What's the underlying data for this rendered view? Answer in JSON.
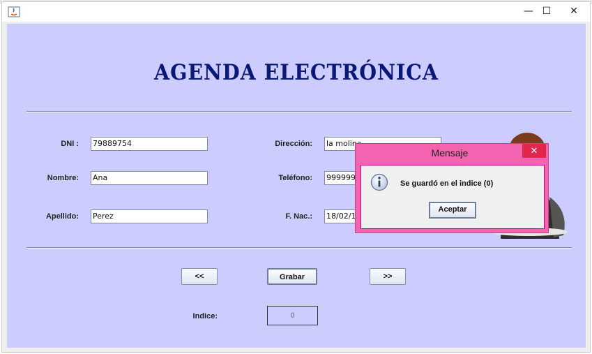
{
  "window": {
    "minimize": "—",
    "maximize": "☐",
    "close": "✕"
  },
  "form": {
    "title": "AGENDA ELECTRÓNICA",
    "dni_label": "DNI :",
    "dni_value": "79889754",
    "nombre_label": "Nombre:",
    "nombre_value": "Ana",
    "apellido_label": "Apellido:",
    "apellido_value": "Perez",
    "direccion_label": "Dirección:",
    "direccion_value": "la molina",
    "telefono_label": "Teléfono:",
    "telefono_value": "9999999",
    "fnac_label": "F. Nac.:",
    "fnac_value": "18/02/19",
    "prev_button": "<<",
    "save_button": "Grabar",
    "next_button": ">>",
    "indice_label": "Indice:",
    "indice_value": "0"
  },
  "dialog": {
    "title": "Mensaje",
    "close": "✕",
    "message": "Se guardó en el indice (0)",
    "ok_button": "Aceptar"
  },
  "colors": {
    "form_background": "#ccccff",
    "title_color": "#0a1877",
    "dialog_frame": "#f263b0",
    "dialog_close": "#e0264c"
  }
}
